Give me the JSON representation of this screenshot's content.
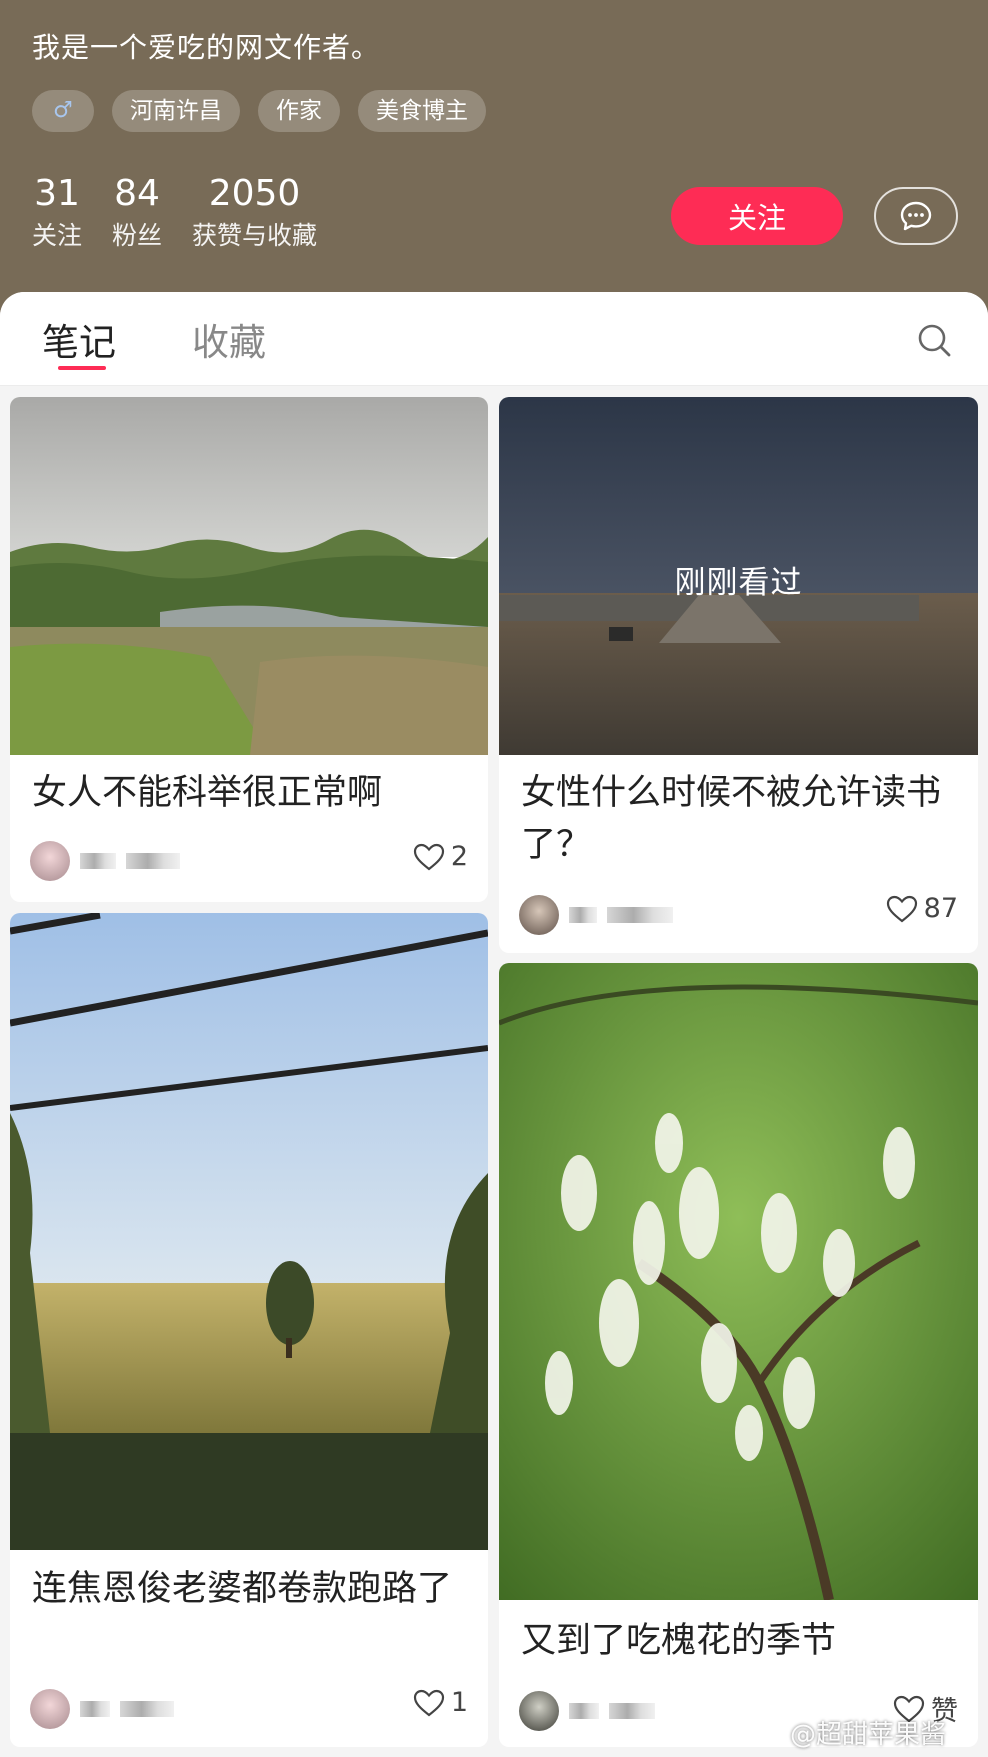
{
  "profile": {
    "bio": "我是一个爱吃的网文作者。",
    "gender_icon": "male-symbol",
    "gender_symbol": "♂",
    "tags": [
      "河南许昌",
      "作家",
      "美食博主"
    ],
    "stats": [
      {
        "value": "31",
        "label": "关注"
      },
      {
        "value": "84",
        "label": "粉丝"
      },
      {
        "value": "2050",
        "label": "获赞与收藏"
      }
    ],
    "follow_label": "关注",
    "message_icon": "chat-bubble-icon"
  },
  "tabs": {
    "notes": "笔记",
    "collections": "收藏",
    "search_icon": "search-icon"
  },
  "notes": [
    {
      "title": "女人不能科举很正常啊",
      "likes": "2"
    },
    {
      "title": "女性什么时候不被允许读书了？",
      "likes": "87",
      "badge": "刚刚看过"
    },
    {
      "title": "连焦恩俊老婆都卷款跑路了",
      "likes": "1"
    },
    {
      "title": "又到了吃槐花的季节",
      "likes": "赞"
    }
  ],
  "colors": {
    "header_bg": "#786b57",
    "accent": "#fe2c55"
  },
  "watermark": "@超甜苹果酱"
}
